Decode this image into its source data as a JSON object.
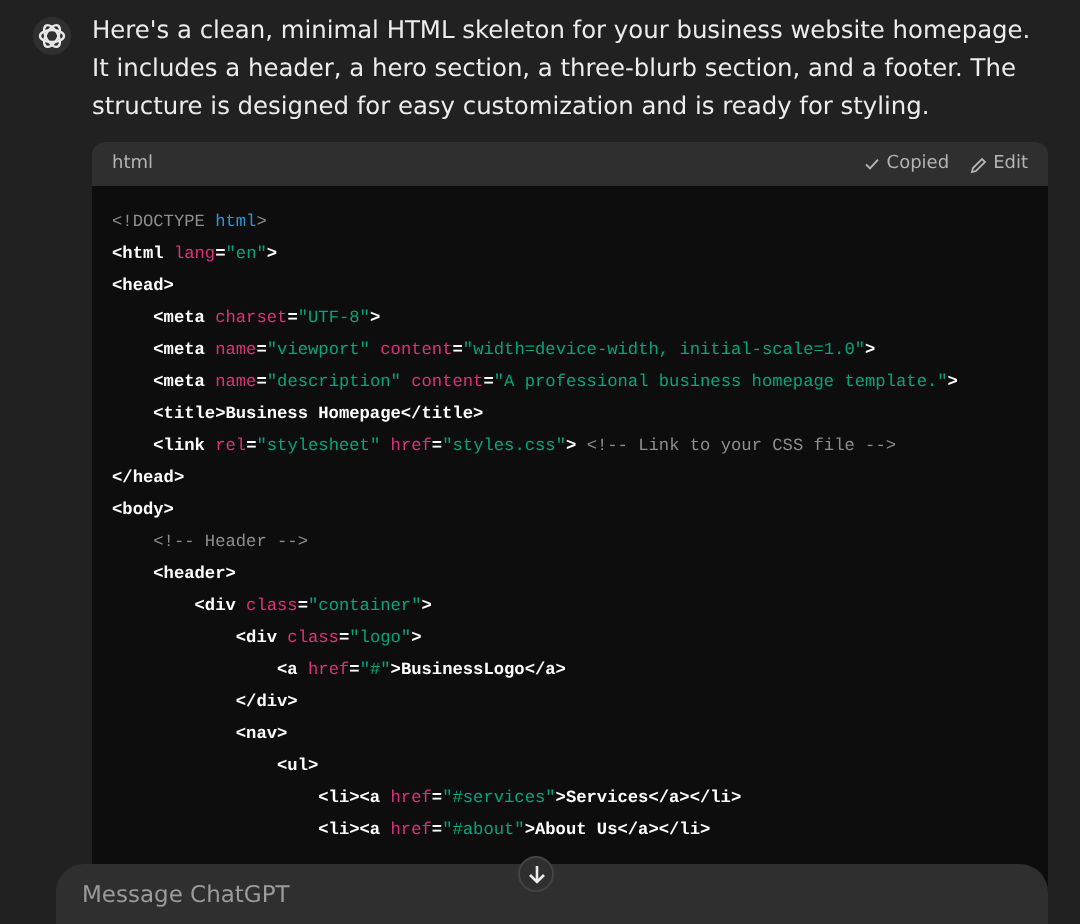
{
  "message": {
    "text": "Here's a clean, minimal HTML skeleton for your business website homepage. It includes a header, a hero section, a three-blurb section, and a footer. The structure is designed for easy customization and is ready for styling."
  },
  "code_block": {
    "language": "html",
    "actions": [
      {
        "kind": "copied",
        "label": "Copied"
      },
      {
        "kind": "edit",
        "label": "Edit"
      }
    ],
    "lines": [
      [
        {
          "kind": "comment",
          "text": "<!DOCTYPE "
        },
        {
          "kind": "keyword",
          "text": "html"
        },
        {
          "kind": "comment",
          "text": ">"
        }
      ],
      [
        {
          "kind": "tag",
          "text": "<html "
        },
        {
          "kind": "attr",
          "text": "lang"
        },
        {
          "kind": "tag",
          "text": "="
        },
        {
          "kind": "str",
          "text": "\"en\""
        },
        {
          "kind": "tag",
          "text": ">"
        }
      ],
      [
        {
          "kind": "tag",
          "text": "<head>"
        }
      ],
      [
        {
          "kind": "tag",
          "text": "    <meta "
        },
        {
          "kind": "attr",
          "text": "charset"
        },
        {
          "kind": "tag",
          "text": "="
        },
        {
          "kind": "str",
          "text": "\"UTF-8\""
        },
        {
          "kind": "tag",
          "text": ">"
        }
      ],
      [
        {
          "kind": "tag",
          "text": "    <meta "
        },
        {
          "kind": "attr",
          "text": "name"
        },
        {
          "kind": "tag",
          "text": "="
        },
        {
          "kind": "str",
          "text": "\"viewport\" "
        },
        {
          "kind": "attr",
          "text": "content"
        },
        {
          "kind": "tag",
          "text": "="
        },
        {
          "kind": "str",
          "text": "\"width=device-width, initial-scale=1.0\""
        },
        {
          "kind": "tag",
          "text": ">"
        }
      ],
      [
        {
          "kind": "tag",
          "text": "    <meta "
        },
        {
          "kind": "attr",
          "text": "name"
        },
        {
          "kind": "tag",
          "text": "="
        },
        {
          "kind": "str",
          "text": "\"description\" "
        },
        {
          "kind": "attr",
          "text": "content"
        },
        {
          "kind": "tag",
          "text": "="
        },
        {
          "kind": "str",
          "text": "\"A professional business homepage template.\""
        },
        {
          "kind": "tag",
          "text": ">"
        }
      ],
      [
        {
          "kind": "tag",
          "text": "    <title>Business Homepage</title>"
        }
      ],
      [
        {
          "kind": "tag",
          "text": "    <link "
        },
        {
          "kind": "attr",
          "text": "rel"
        },
        {
          "kind": "tag",
          "text": "="
        },
        {
          "kind": "str",
          "text": "\"stylesheet\" "
        },
        {
          "kind": "attr",
          "text": "href"
        },
        {
          "kind": "tag",
          "text": "="
        },
        {
          "kind": "str",
          "text": "\"styles.css\""
        },
        {
          "kind": "tag",
          "text": "> "
        },
        {
          "kind": "comment",
          "text": "<!-- Link to your CSS file -->"
        }
      ],
      [
        {
          "kind": "tag",
          "text": "</head>"
        }
      ],
      [
        {
          "kind": "tag",
          "text": "<body>"
        }
      ],
      [
        {
          "kind": "comment",
          "text": "    <!-- Header -->"
        }
      ],
      [
        {
          "kind": "tag",
          "text": "    <header>"
        }
      ],
      [
        {
          "kind": "tag",
          "text": "        <div "
        },
        {
          "kind": "attr",
          "text": "class"
        },
        {
          "kind": "tag",
          "text": "="
        },
        {
          "kind": "str",
          "text": "\"container\""
        },
        {
          "kind": "tag",
          "text": ">"
        }
      ],
      [
        {
          "kind": "tag",
          "text": "            <div "
        },
        {
          "kind": "attr",
          "text": "class"
        },
        {
          "kind": "tag",
          "text": "="
        },
        {
          "kind": "str",
          "text": "\"logo\""
        },
        {
          "kind": "tag",
          "text": ">"
        }
      ],
      [
        {
          "kind": "tag",
          "text": "                <a "
        },
        {
          "kind": "attr",
          "text": "href"
        },
        {
          "kind": "tag",
          "text": "="
        },
        {
          "kind": "str",
          "text": "\"#\""
        },
        {
          "kind": "tag",
          "text": ">BusinessLogo</a>"
        }
      ],
      [
        {
          "kind": "tag",
          "text": "            </div>"
        }
      ],
      [
        {
          "kind": "tag",
          "text": "            <nav>"
        }
      ],
      [
        {
          "kind": "tag",
          "text": "                <ul>"
        }
      ],
      [
        {
          "kind": "tag",
          "text": "                    <li><a "
        },
        {
          "kind": "attr",
          "text": "href"
        },
        {
          "kind": "tag",
          "text": "="
        },
        {
          "kind": "str",
          "text": "\"#services\""
        },
        {
          "kind": "tag",
          "text": ">Services</a></li>"
        }
      ],
      [
        {
          "kind": "tag",
          "text": "                    <li><a "
        },
        {
          "kind": "attr",
          "text": "href"
        },
        {
          "kind": "tag",
          "text": "="
        },
        {
          "kind": "str",
          "text": "\"#about\""
        },
        {
          "kind": "tag",
          "text": ">About Us</a></li>"
        }
      ]
    ]
  },
  "composer": {
    "placeholder": "Message ChatGPT"
  }
}
